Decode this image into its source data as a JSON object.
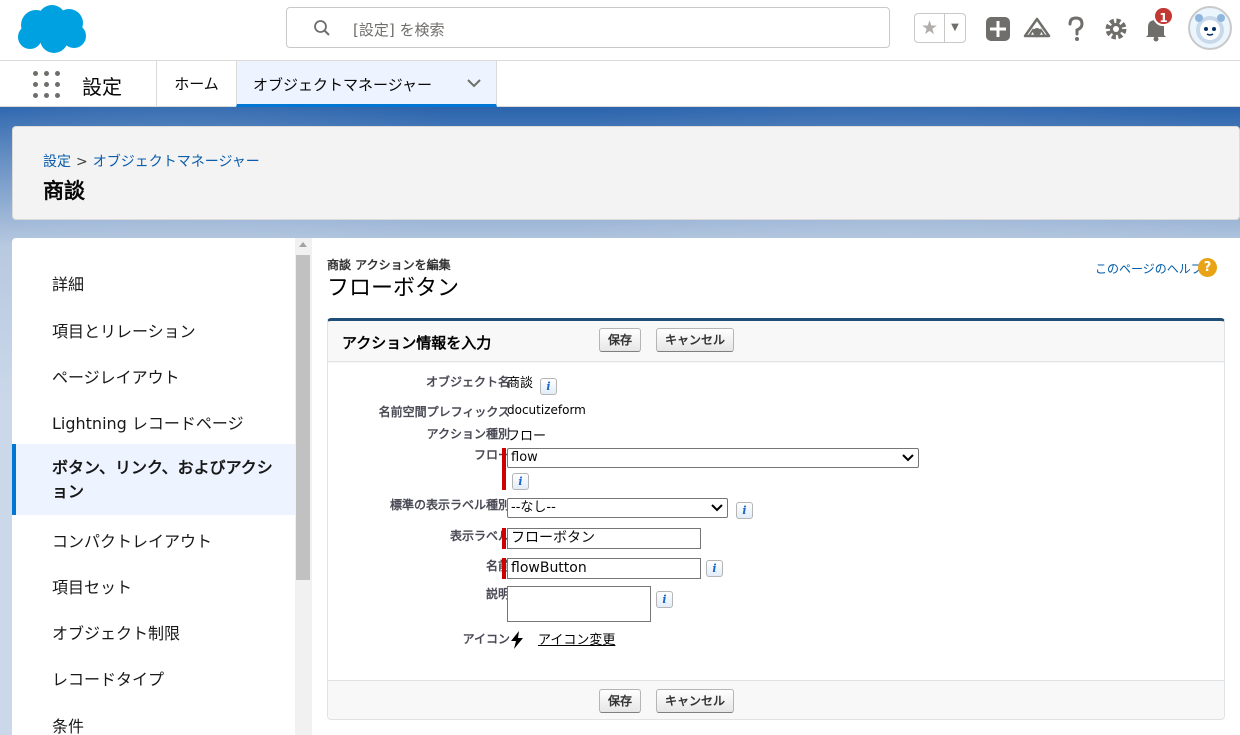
{
  "header": {
    "search_placeholder": "[設定] を検索",
    "notification_count": "1"
  },
  "nav": {
    "app_name": "設定",
    "tabs": [
      {
        "label": "ホーム"
      },
      {
        "label": "オブジェクトマネージャー"
      }
    ]
  },
  "page_header": {
    "breadcrumb_root": "設定",
    "breadcrumb_sep": ">",
    "breadcrumb_current": "オブジェクトマネージャー",
    "title": "商談"
  },
  "sidebar": {
    "items": [
      {
        "label": "詳細"
      },
      {
        "label": "項目とリレーション"
      },
      {
        "label": "ページレイアウト"
      },
      {
        "label": "Lightning レコードページ"
      },
      {
        "label": "ボタン、リンク、およびアクション"
      },
      {
        "label": "コンパクトレイアウト"
      },
      {
        "label": "項目セット"
      },
      {
        "label": "オブジェクト制限"
      },
      {
        "label": "レコードタイプ"
      },
      {
        "label": "条件"
      }
    ],
    "active_index": 4
  },
  "main": {
    "crumb": "商談 アクションを編集",
    "title": "フローボタン",
    "help_link": "このページのヘルプ",
    "help_icon": "?",
    "section_title": "アクション情報を入力",
    "save_label": "保存",
    "cancel_label": "キャンセル",
    "info_glyph": "i",
    "fields": {
      "object_name_label": "オブジェクト名",
      "object_name_value": "商談",
      "namespace_label": "名前空間プレフィックス",
      "namespace_value": "docutizeform",
      "action_type_label": "アクション種別",
      "action_type_value": "フロー",
      "flow_label": "フロー",
      "flow_value": "flow",
      "std_label_type_label": "標準の表示ラベル種別",
      "std_label_type_value": "--なし--",
      "display_label_label": "表示ラベル",
      "display_label_value": "フローボタン",
      "name_label": "名前",
      "name_value": "flowButton",
      "description_label": "説明",
      "description_value": "",
      "icon_label": "アイコン",
      "icon_change_link": "アイコン変更"
    }
  },
  "colors": {
    "brand_blue": "#00a1e0",
    "link_blue": "#0b5cab",
    "required_red": "#c00000",
    "badge_red": "#c23934",
    "active_nav": "#0176d3"
  }
}
